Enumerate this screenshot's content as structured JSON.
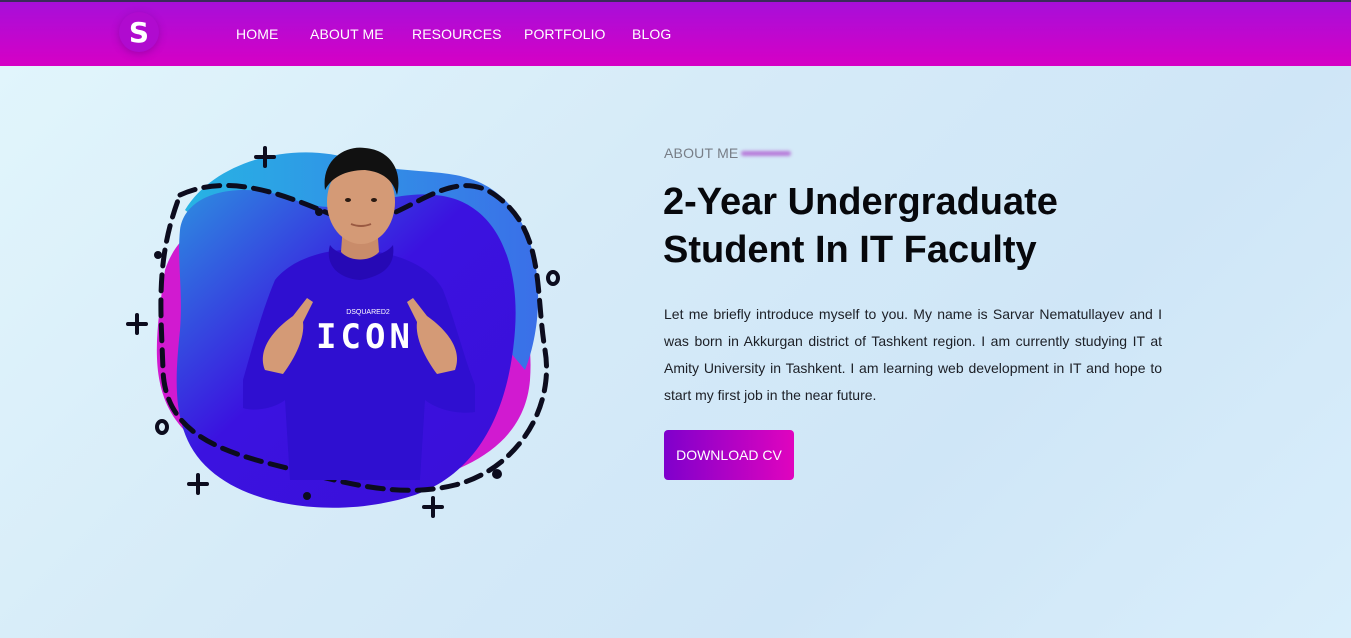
{
  "nav": {
    "logo_letter": "S",
    "items": [
      {
        "label": "HOME"
      },
      {
        "label": "ABOUT ME"
      },
      {
        "label": "RESOURCES"
      },
      {
        "label": "PORTFOLIO"
      },
      {
        "label": "BLOG"
      }
    ]
  },
  "hero": {
    "eyebrow": "ABOUT ME",
    "headline_line1": "2-Year Undergraduate",
    "headline_line2": "Student In IT Faculty",
    "intro": "Let me briefly introduce myself to you. My name is Sarvar Nematullayev and I was born in Akkurgan district of Tashkent region. I am currently studying IT at Amity University in Tashkent. I am learning web development in IT and hope to start my first job in the near future.",
    "cta_label": "DOWNLOAD CV",
    "shirt_small_text": "DSQUARED2",
    "shirt_big_text": "ICON"
  },
  "colors": {
    "nav_gradient_start": "#a70fd9",
    "nav_gradient_end": "#d600c5",
    "cta_gradient_start": "#7f00cc",
    "cta_gradient_end": "#e004be",
    "blob_purple": "#3b12e0",
    "blob_cyan": "#27b4e4",
    "blob_magenta": "#d11ad0"
  }
}
